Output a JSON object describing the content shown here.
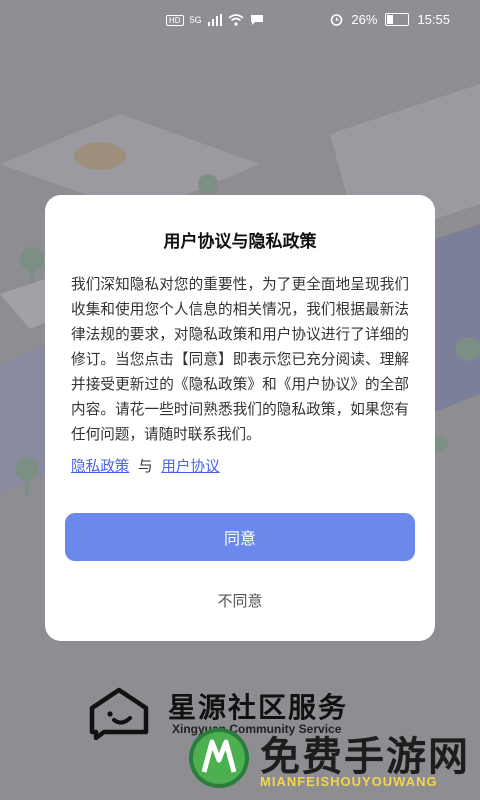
{
  "status_bar": {
    "hd_badge": "HD",
    "network": "5G",
    "battery": "26%",
    "battery_level": 0.26,
    "time": "15:55"
  },
  "dialog": {
    "title": "用户协议与隐私政策",
    "body": "我们深知隐私对您的重要性，为了更全面地呈现我们收集和使用您个人信息的相关情况，我们根据最新法律法规的要求，对隐私政策和用户协议进行了详细的修订。当您点击【同意】即表示您已充分阅读、理解并接受更新过的《隐私政策》和《用户协议》的全部内容。请花一些时间熟悉我们的隐私政策，如果您有任何问题，请随时联系我们。",
    "privacy_link": "隐私政策",
    "conjunction": "与",
    "user_agreement_link": "用户协议",
    "agree_label": "同意",
    "disagree_label": "不同意"
  },
  "brand": {
    "name": "星源社区服务",
    "subtitle": "Xingyuan Community Service"
  },
  "watermark": {
    "text": "免费手游网",
    "sub": "MIANFEISHOUYOUWANG"
  },
  "colors": {
    "accent": "#6b88ed",
    "link": "#4a64e4",
    "overlay": "#8f8f93"
  },
  "icons": [
    "signal-icon",
    "wifi-icon",
    "message-icon",
    "alarm-icon",
    "battery-icon",
    "app-logo-icon",
    "watermark-logo-icon"
  ]
}
